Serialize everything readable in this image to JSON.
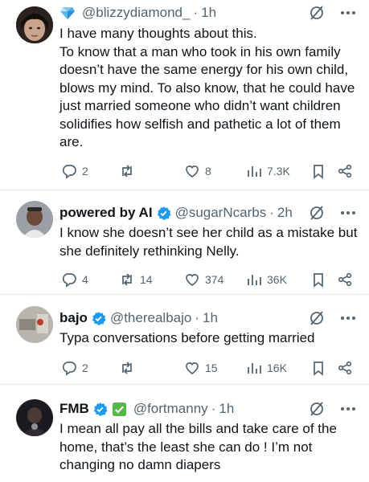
{
  "tweets": [
    {
      "name": "",
      "handle": "@blizzydiamond_",
      "time": "1h",
      "badge_icon": "diamond-emoji-icon",
      "text_lines": [
        "I have many thoughts about this.",
        "To know that a man who took in his own family doesn’t have the same energy for his own child, blows my mind. To also know, that he could have just married someone who didn’t want children solidifies how selfish and pathetic a lot of them are."
      ],
      "replies": "2",
      "reposts": "",
      "likes": "8",
      "views": "7.3K"
    },
    {
      "name": "powered by AI",
      "handle": "@sugarNcarbs",
      "time": "2h",
      "badge_icon": "verified-badge-icon",
      "text_lines": [
        "I know she doesn’t see her child as a mistake but she definitely rethinking Nelly."
      ],
      "replies": "4",
      "reposts": "14",
      "likes": "374",
      "views": "36K"
    },
    {
      "name": "bajo",
      "handle": "@therealbajo",
      "time": "1h",
      "badge_icon": "verified-badge-icon",
      "text_lines": [
        "Typa conversations before getting married"
      ],
      "replies": "2",
      "reposts": "",
      "likes": "15",
      "views": "16K"
    },
    {
      "name": "FMB",
      "handle": "@fortmanny",
      "time": "1h",
      "badge_icon": "verified-badge-icon",
      "text_lines": [
        "I mean all pay all the bills and take care of the home, that’s the least she can do ! I’m not changing no damn diapers"
      ],
      "replies": "",
      "reposts": "",
      "likes": "",
      "views": ""
    }
  ],
  "colors": {
    "text": "#0f1419",
    "secondary": "#536471",
    "verified": "#1d9bf0",
    "divider": "#e7e9ea"
  }
}
